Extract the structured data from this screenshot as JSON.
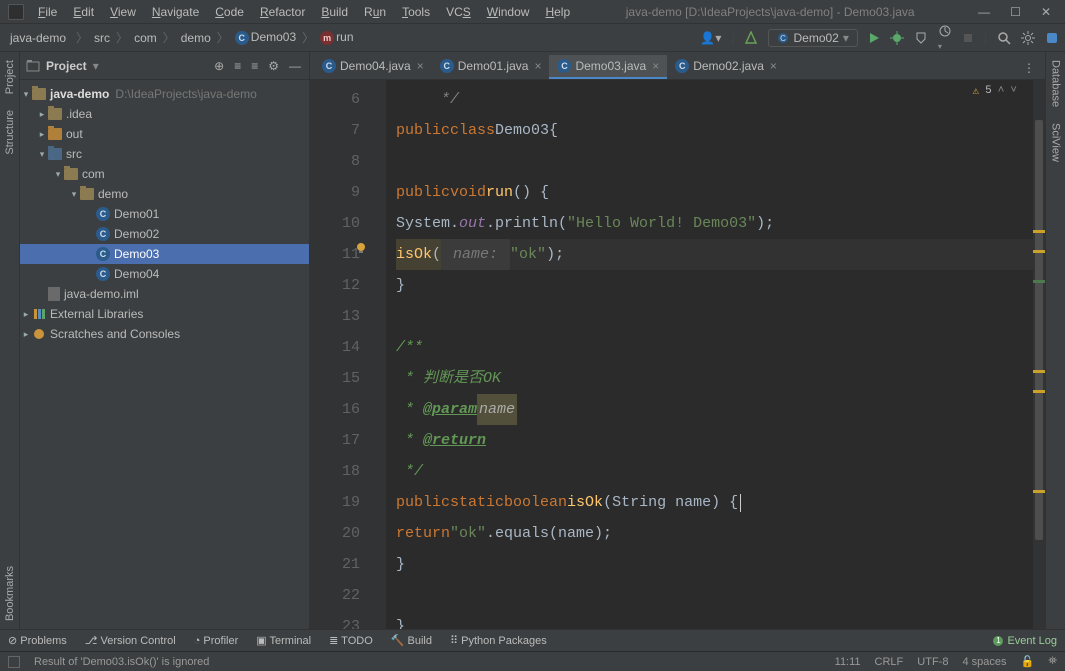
{
  "window": {
    "title": "java-demo [D:\\IdeaProjects\\java-demo] - Demo03.java"
  },
  "menu": [
    "File",
    "Edit",
    "View",
    "Navigate",
    "Code",
    "Refactor",
    "Build",
    "Run",
    "Tools",
    "VCS",
    "Window",
    "Help"
  ],
  "breadcrumb": [
    "java-demo",
    "src",
    "com",
    "demo",
    "Demo03",
    "run"
  ],
  "run_config": "Demo02",
  "project_panel_title": "Project",
  "tree": {
    "root_name": "java-demo",
    "root_sub": "D:\\IdeaProjects\\java-demo",
    "items": [
      {
        "label": ".idea"
      },
      {
        "label": "out"
      },
      {
        "label": "src"
      },
      {
        "label": "com"
      },
      {
        "label": "demo"
      },
      {
        "label": "Demo01"
      },
      {
        "label": "Demo02"
      },
      {
        "label": "Demo03"
      },
      {
        "label": "Demo04"
      },
      {
        "label": "java-demo.iml"
      },
      {
        "label": "External Libraries"
      },
      {
        "label": "Scratches and Consoles"
      }
    ]
  },
  "tabs": [
    "Demo04.java",
    "Demo01.java",
    "Demo03.java",
    "Demo02.java"
  ],
  "active_tab": "Demo03.java",
  "inspection_count": "5",
  "code_lines": {
    "first_num": 6,
    "lines": [
      " */",
      "public class Demo03 {",
      "",
      "    public void run() {",
      "        System.out.println(\"Hello World! Demo03\");",
      "        isOk( name: \"ok\");",
      "    }",
      "",
      "    /**",
      "     * 判断是否OK",
      "     * @param name",
      "     * @return",
      "     */",
      "    public static boolean isOk(String name) {",
      "        return \"ok\".equals(name);",
      "    }",
      "",
      "}"
    ]
  },
  "bottom_tools": [
    "Problems",
    "Version Control",
    "Profiler",
    "Terminal",
    "TODO",
    "Build",
    "Python Packages"
  ],
  "event_log": "Event Log",
  "status": {
    "message": "Result of 'Demo03.isOk()' is ignored",
    "line_col": "11:11",
    "eol": "CRLF",
    "encoding": "UTF-8",
    "indent": "4 spaces"
  },
  "side_tabs_left": [
    "Project",
    "Structure",
    "Bookmarks"
  ],
  "side_tabs_right": [
    "Database",
    "SciView"
  ]
}
